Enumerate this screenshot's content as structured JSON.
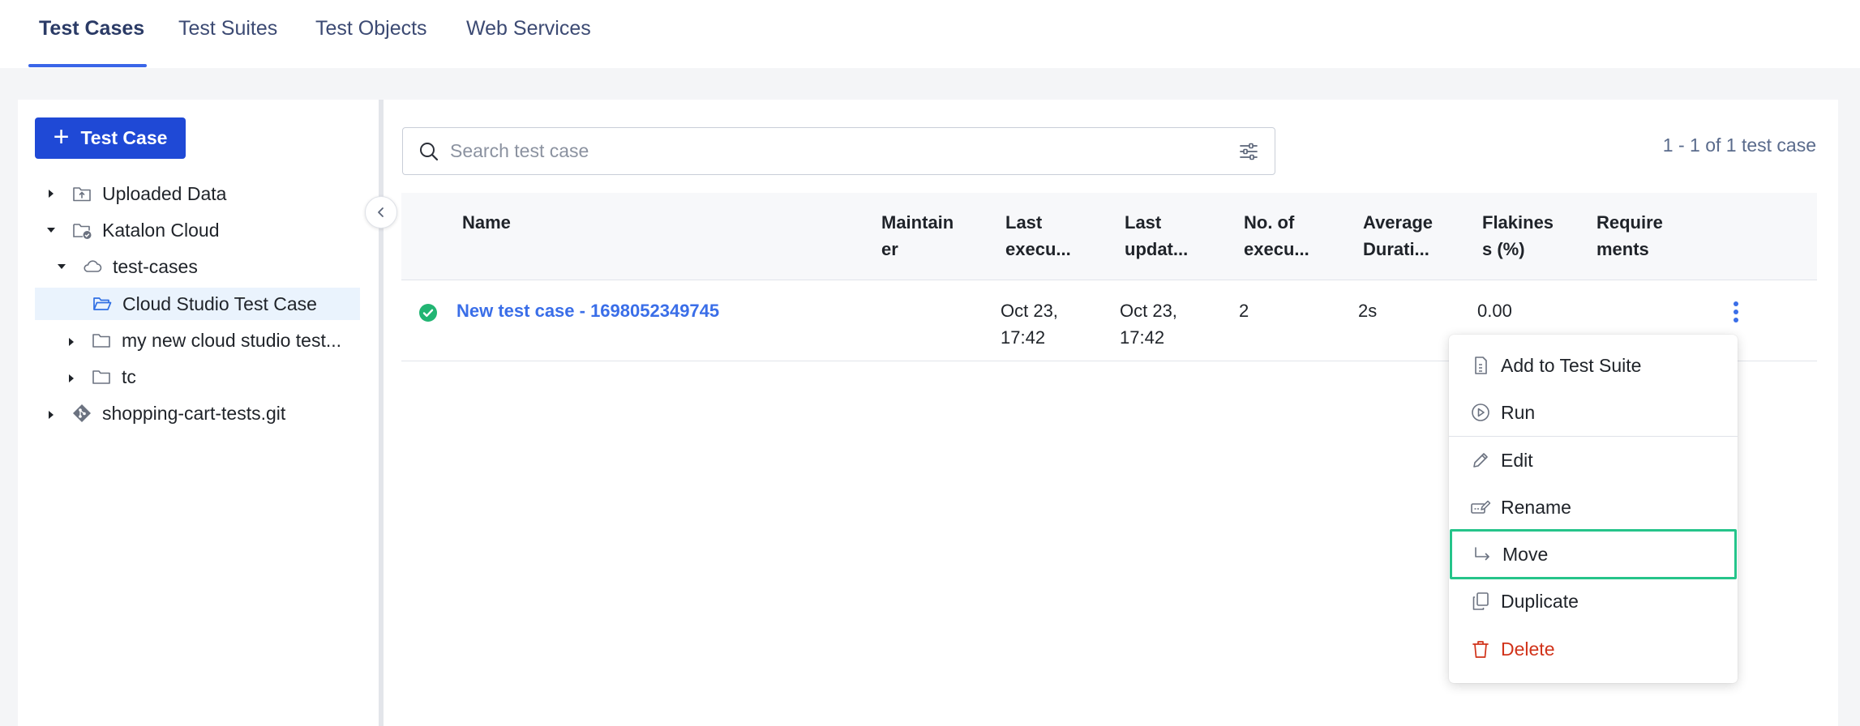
{
  "tabs": [
    {
      "label": "Test Cases",
      "active": true
    },
    {
      "label": "Test Suites",
      "active": false
    },
    {
      "label": "Test Objects",
      "active": false
    },
    {
      "label": "Web Services",
      "active": false
    }
  ],
  "sidebar": {
    "add_button": "Test Case",
    "tree": [
      {
        "label": "Uploaded Data",
        "icon": "upload-folder-icon",
        "expanded": false
      },
      {
        "label": "Katalon Cloud",
        "icon": "cloud-repo-icon",
        "expanded": true
      },
      {
        "label": "test-cases",
        "icon": "cloud-icon",
        "expanded": true
      },
      {
        "label": "Cloud Studio Test Case",
        "icon": "open-folder-icon",
        "selected": true
      },
      {
        "label": "my new cloud studio test...",
        "icon": "folder-icon",
        "expanded": false
      },
      {
        "label": "tc",
        "icon": "folder-icon",
        "expanded": false
      },
      {
        "label": "shopping-cart-tests.git",
        "icon": "git-icon",
        "expanded": false
      }
    ]
  },
  "search": {
    "placeholder": "Search test case",
    "value": ""
  },
  "pagination": {
    "summary": "1 - 1 of 1 test case"
  },
  "table": {
    "columns": [
      "Name",
      "Maintain\ner",
      "Last\nexecu...",
      "Last\nupdat...",
      "No. of\nexecu...",
      "Average\nDurati...",
      "Flakines\ns (%)",
      "Require\nments"
    ],
    "rows": [
      {
        "status": "passed",
        "name": "New test case - 1698052349745",
        "maintainer": "",
        "last_executed": "Oct 23,\n17:42",
        "last_updated": "Oct 23,\n17:42",
        "executions": "2",
        "avg_duration": "2s",
        "flakiness": "0.00",
        "requirements": ""
      }
    ]
  },
  "context_menu": {
    "items": [
      {
        "label": "Add to Test Suite",
        "icon": "document-icon"
      },
      {
        "label": "Run",
        "icon": "play-circle-icon"
      },
      {
        "label": "Edit",
        "icon": "pencil-icon"
      },
      {
        "label": "Rename",
        "icon": "rename-icon"
      },
      {
        "label": "Move",
        "icon": "move-arrow-icon",
        "highlighted": true
      },
      {
        "label": "Duplicate",
        "icon": "duplicate-icon"
      },
      {
        "label": "Delete",
        "icon": "trash-icon",
        "danger": true
      }
    ]
  },
  "colors": {
    "primary": "#1f49d6",
    "link": "#3a6ee8",
    "success": "#22b573",
    "danger": "#d1331a",
    "highlight_border": "#25c48a"
  }
}
